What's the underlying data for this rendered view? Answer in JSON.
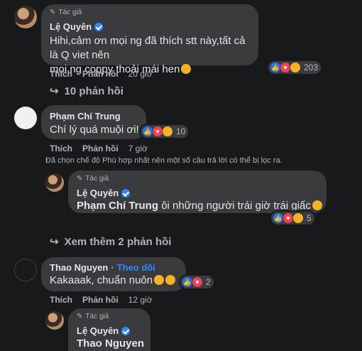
{
  "badges": {
    "author": "Tác giả"
  },
  "comments": [
    {
      "name": "Lệ Quyên",
      "text_line1": "Hihi,cảm ơn mọi ng đã thích stt này,tất cả là Q viet nên",
      "text_line2": "moi ng coppy thoải mái hen",
      "like": "Thích",
      "reply": "Phản hồi",
      "time": "20 giờ",
      "reaction_count": "203"
    },
    {
      "name": "Phạm Chí Trung",
      "text": "Chí lý quá muội ơi!",
      "like": "Thích",
      "reply": "Phản hồi",
      "time": "7 giờ",
      "reaction_count": "10"
    },
    {
      "name": "Lệ Quyên",
      "mention": "Phạm Chí Trung",
      "text": "ôi những người trái giờ trái giấc",
      "reaction_count": "5"
    },
    {
      "name": "Thao Nguyen",
      "follow": "Theo dõi",
      "text": "Kakaaak, chuẩn nuôn",
      "like": "Thích",
      "reply": "Phản hồi",
      "time": "12 giờ",
      "reaction_count": "2"
    },
    {
      "name": "Lệ Quyên",
      "mention": "Thao Nguyen"
    }
  ],
  "toggles": {
    "replies_10": "10 phản hồi",
    "see_more_2": "Xem thêm 2 phản hồi"
  },
  "filter_note": "Đã chọn chế độ Phù hợp nhất nên một số câu trả lời có thể bị lọc ra.",
  "icons": {
    "pencil": "pencil-icon",
    "verified": "verified-badge-icon",
    "reply_arrow": "reply-arrow-icon"
  }
}
